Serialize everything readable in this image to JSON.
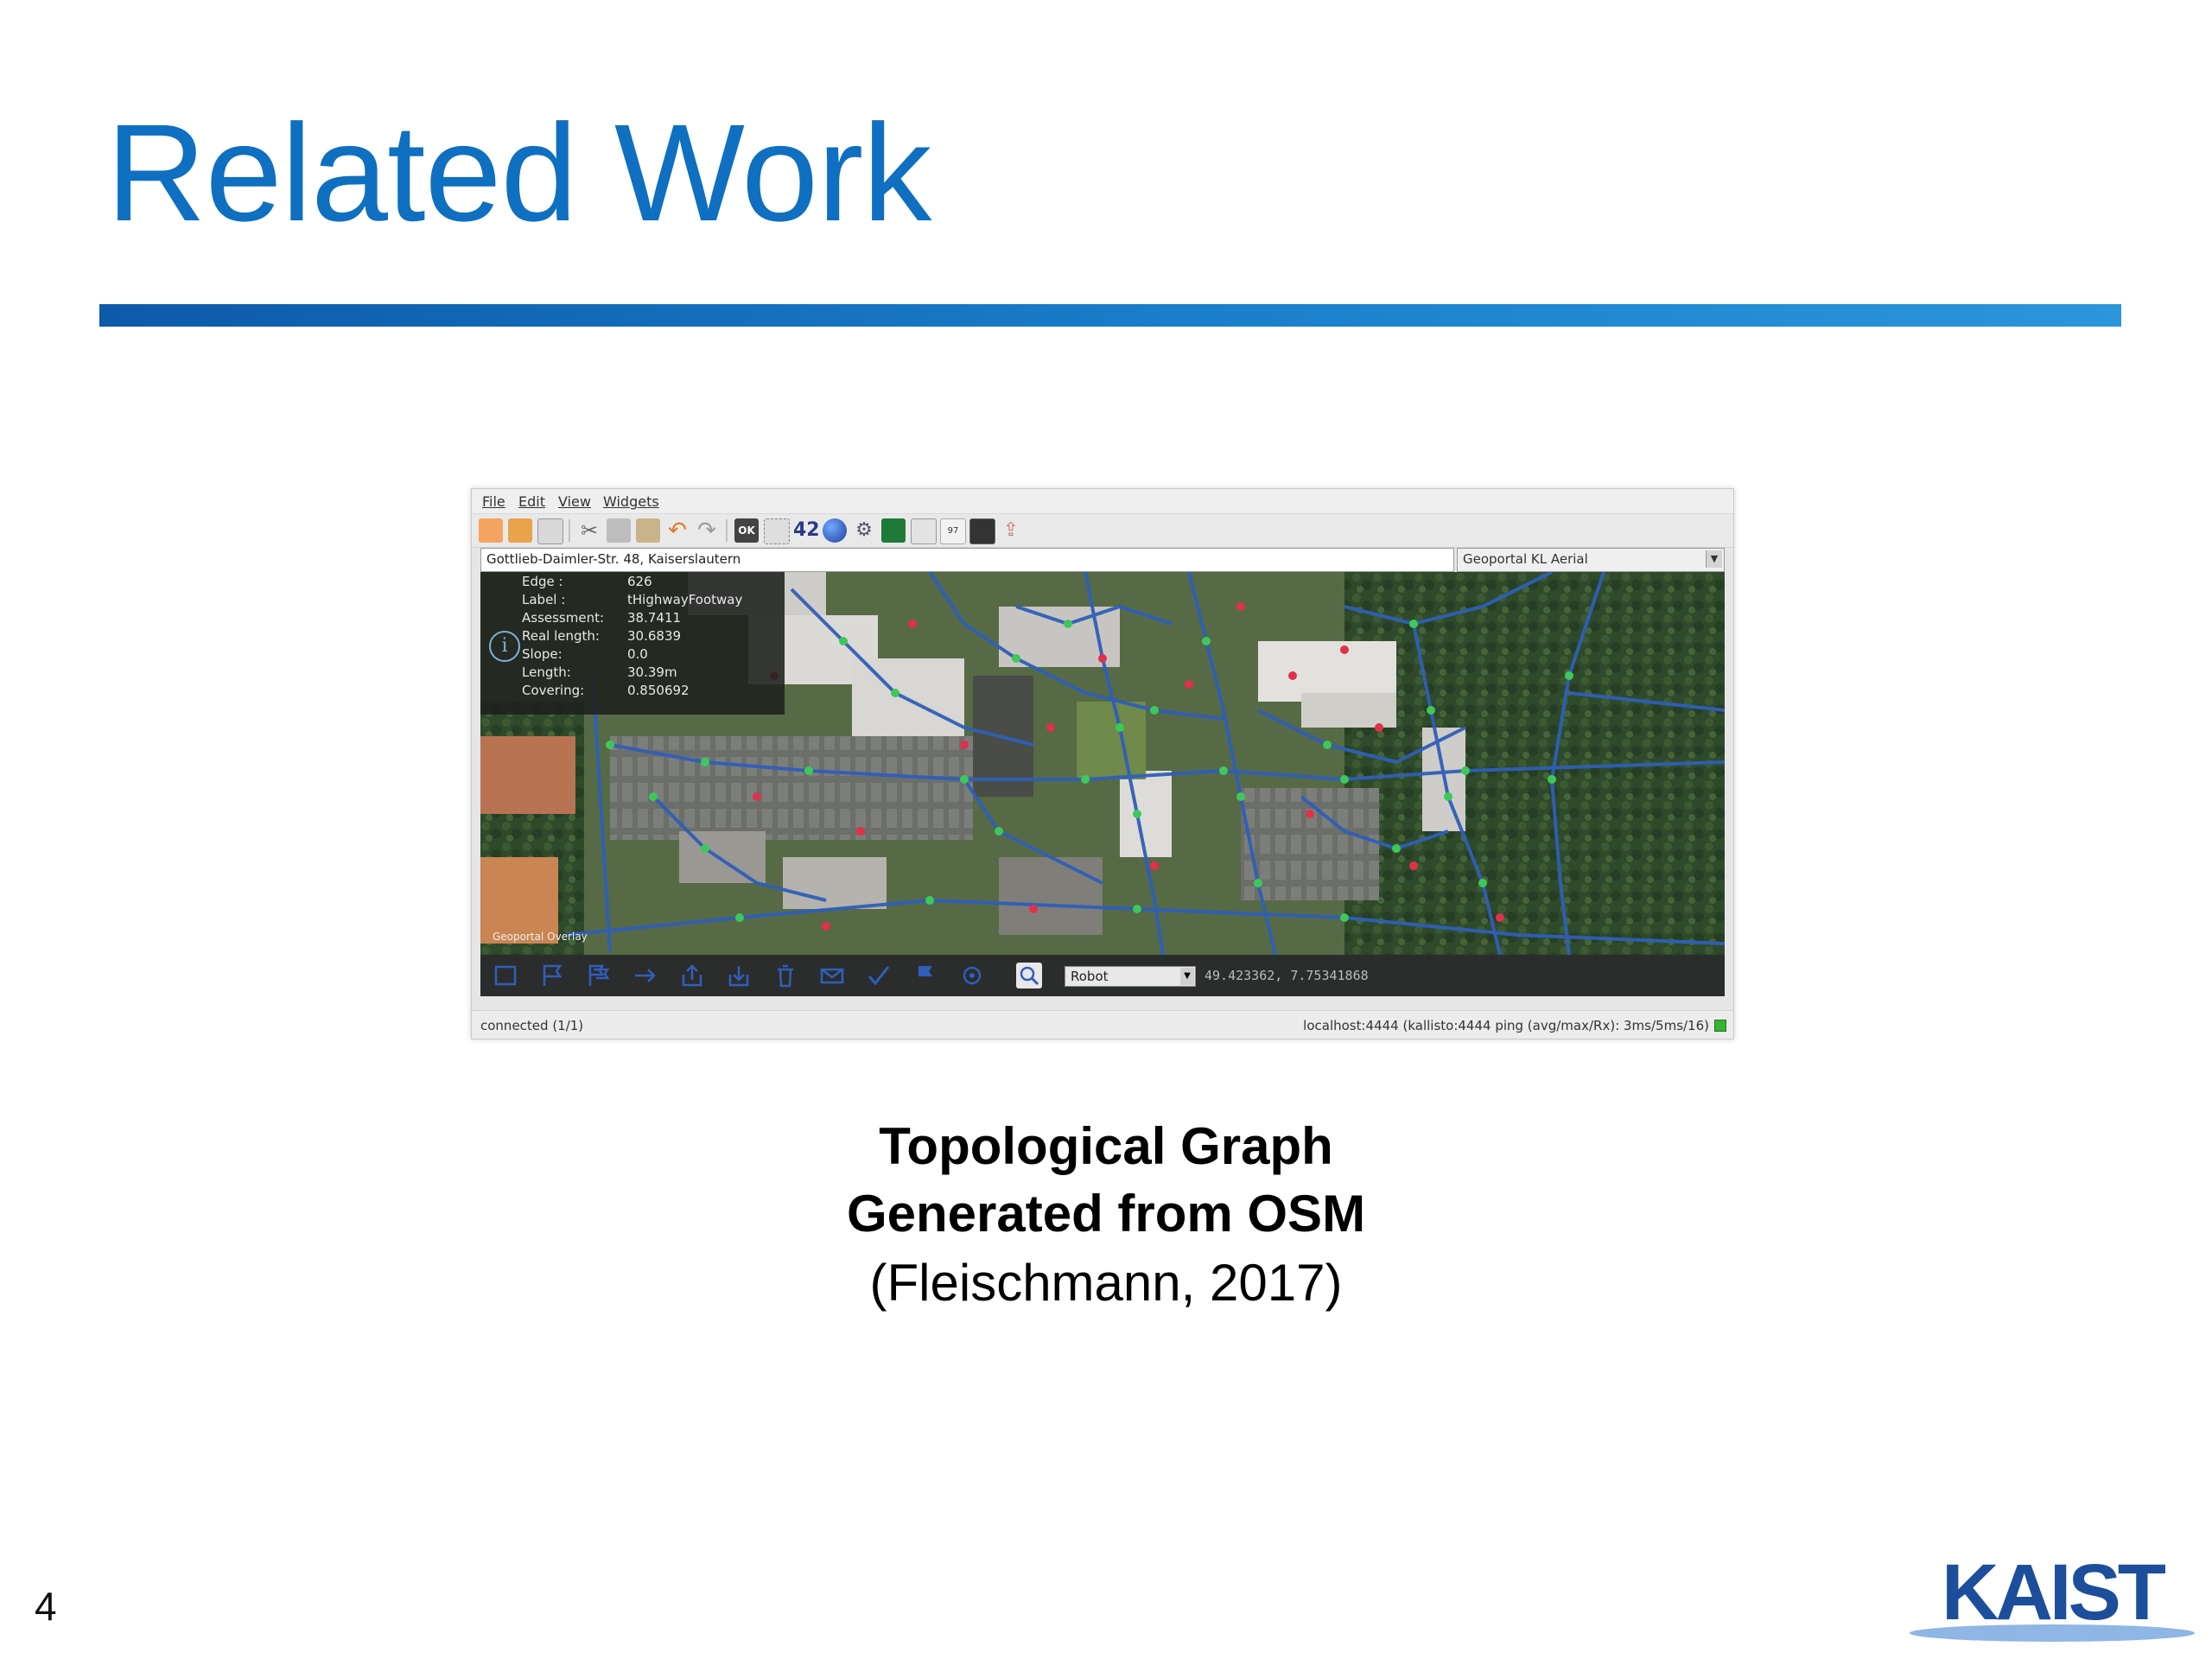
{
  "slide": {
    "title": "Related Work",
    "page_number": "4",
    "logo_text": "KAIST",
    "caption": {
      "line1": "Topological Graph",
      "line2": "Generated from OSM",
      "line3": "(Fleischmann, 2017)"
    }
  },
  "app": {
    "menu": [
      "File",
      "Edit",
      "View",
      "Widgets"
    ],
    "toolbar_icons": [
      "new-icon",
      "open-icon",
      "save-icon",
      "cut-icon",
      "copy-icon",
      "paste-icon",
      "undo-icon",
      "redo-icon",
      "ok-icon",
      "select-icon",
      "counter-icon",
      "globe-icon",
      "network-icon",
      "grid-icon",
      "graph-icon",
      "text-icon",
      "map-icon",
      "export-icon"
    ],
    "address": "Gottlieb-Daimler-Str. 48, Kaiserslautern",
    "map_source": "Geoportal KL Aerial",
    "info_panel": [
      {
        "key": "Edge :",
        "value": "626"
      },
      {
        "key": "Label :",
        "value": "tHighwayFootway"
      },
      {
        "key": "Assessment:",
        "value": "38.7411"
      },
      {
        "key": "Real length:",
        "value": "30.6839"
      },
      {
        "key": "Slope:",
        "value": "0.0"
      },
      {
        "key": "Length:",
        "value": "30.39m"
      },
      {
        "key": "Covering:",
        "value": "0.850692"
      }
    ],
    "map_scale_label": "Geoportal Overlay",
    "bottom_icons": [
      "rectangle-icon",
      "flag-outline-icon",
      "flags-icon",
      "arrow-right-icon",
      "upload-icon",
      "download-icon",
      "trash-icon",
      "mail-icon",
      "check-icon",
      "flag-icon",
      "target-icon",
      "search-icon"
    ],
    "robot_select": "Robot",
    "coordinates": "49.423362, 7.75341868",
    "status_left": "connected (1/1)",
    "status_right": "localhost:4444 (kallisto:4444 ping (avg/max/Rx): 3ms/5ms/16)"
  },
  "colors": {
    "title": "#0f6fc0",
    "edge": "#2f5fb8",
    "node_green": "#3ec85a",
    "node_red": "#e0304a"
  }
}
